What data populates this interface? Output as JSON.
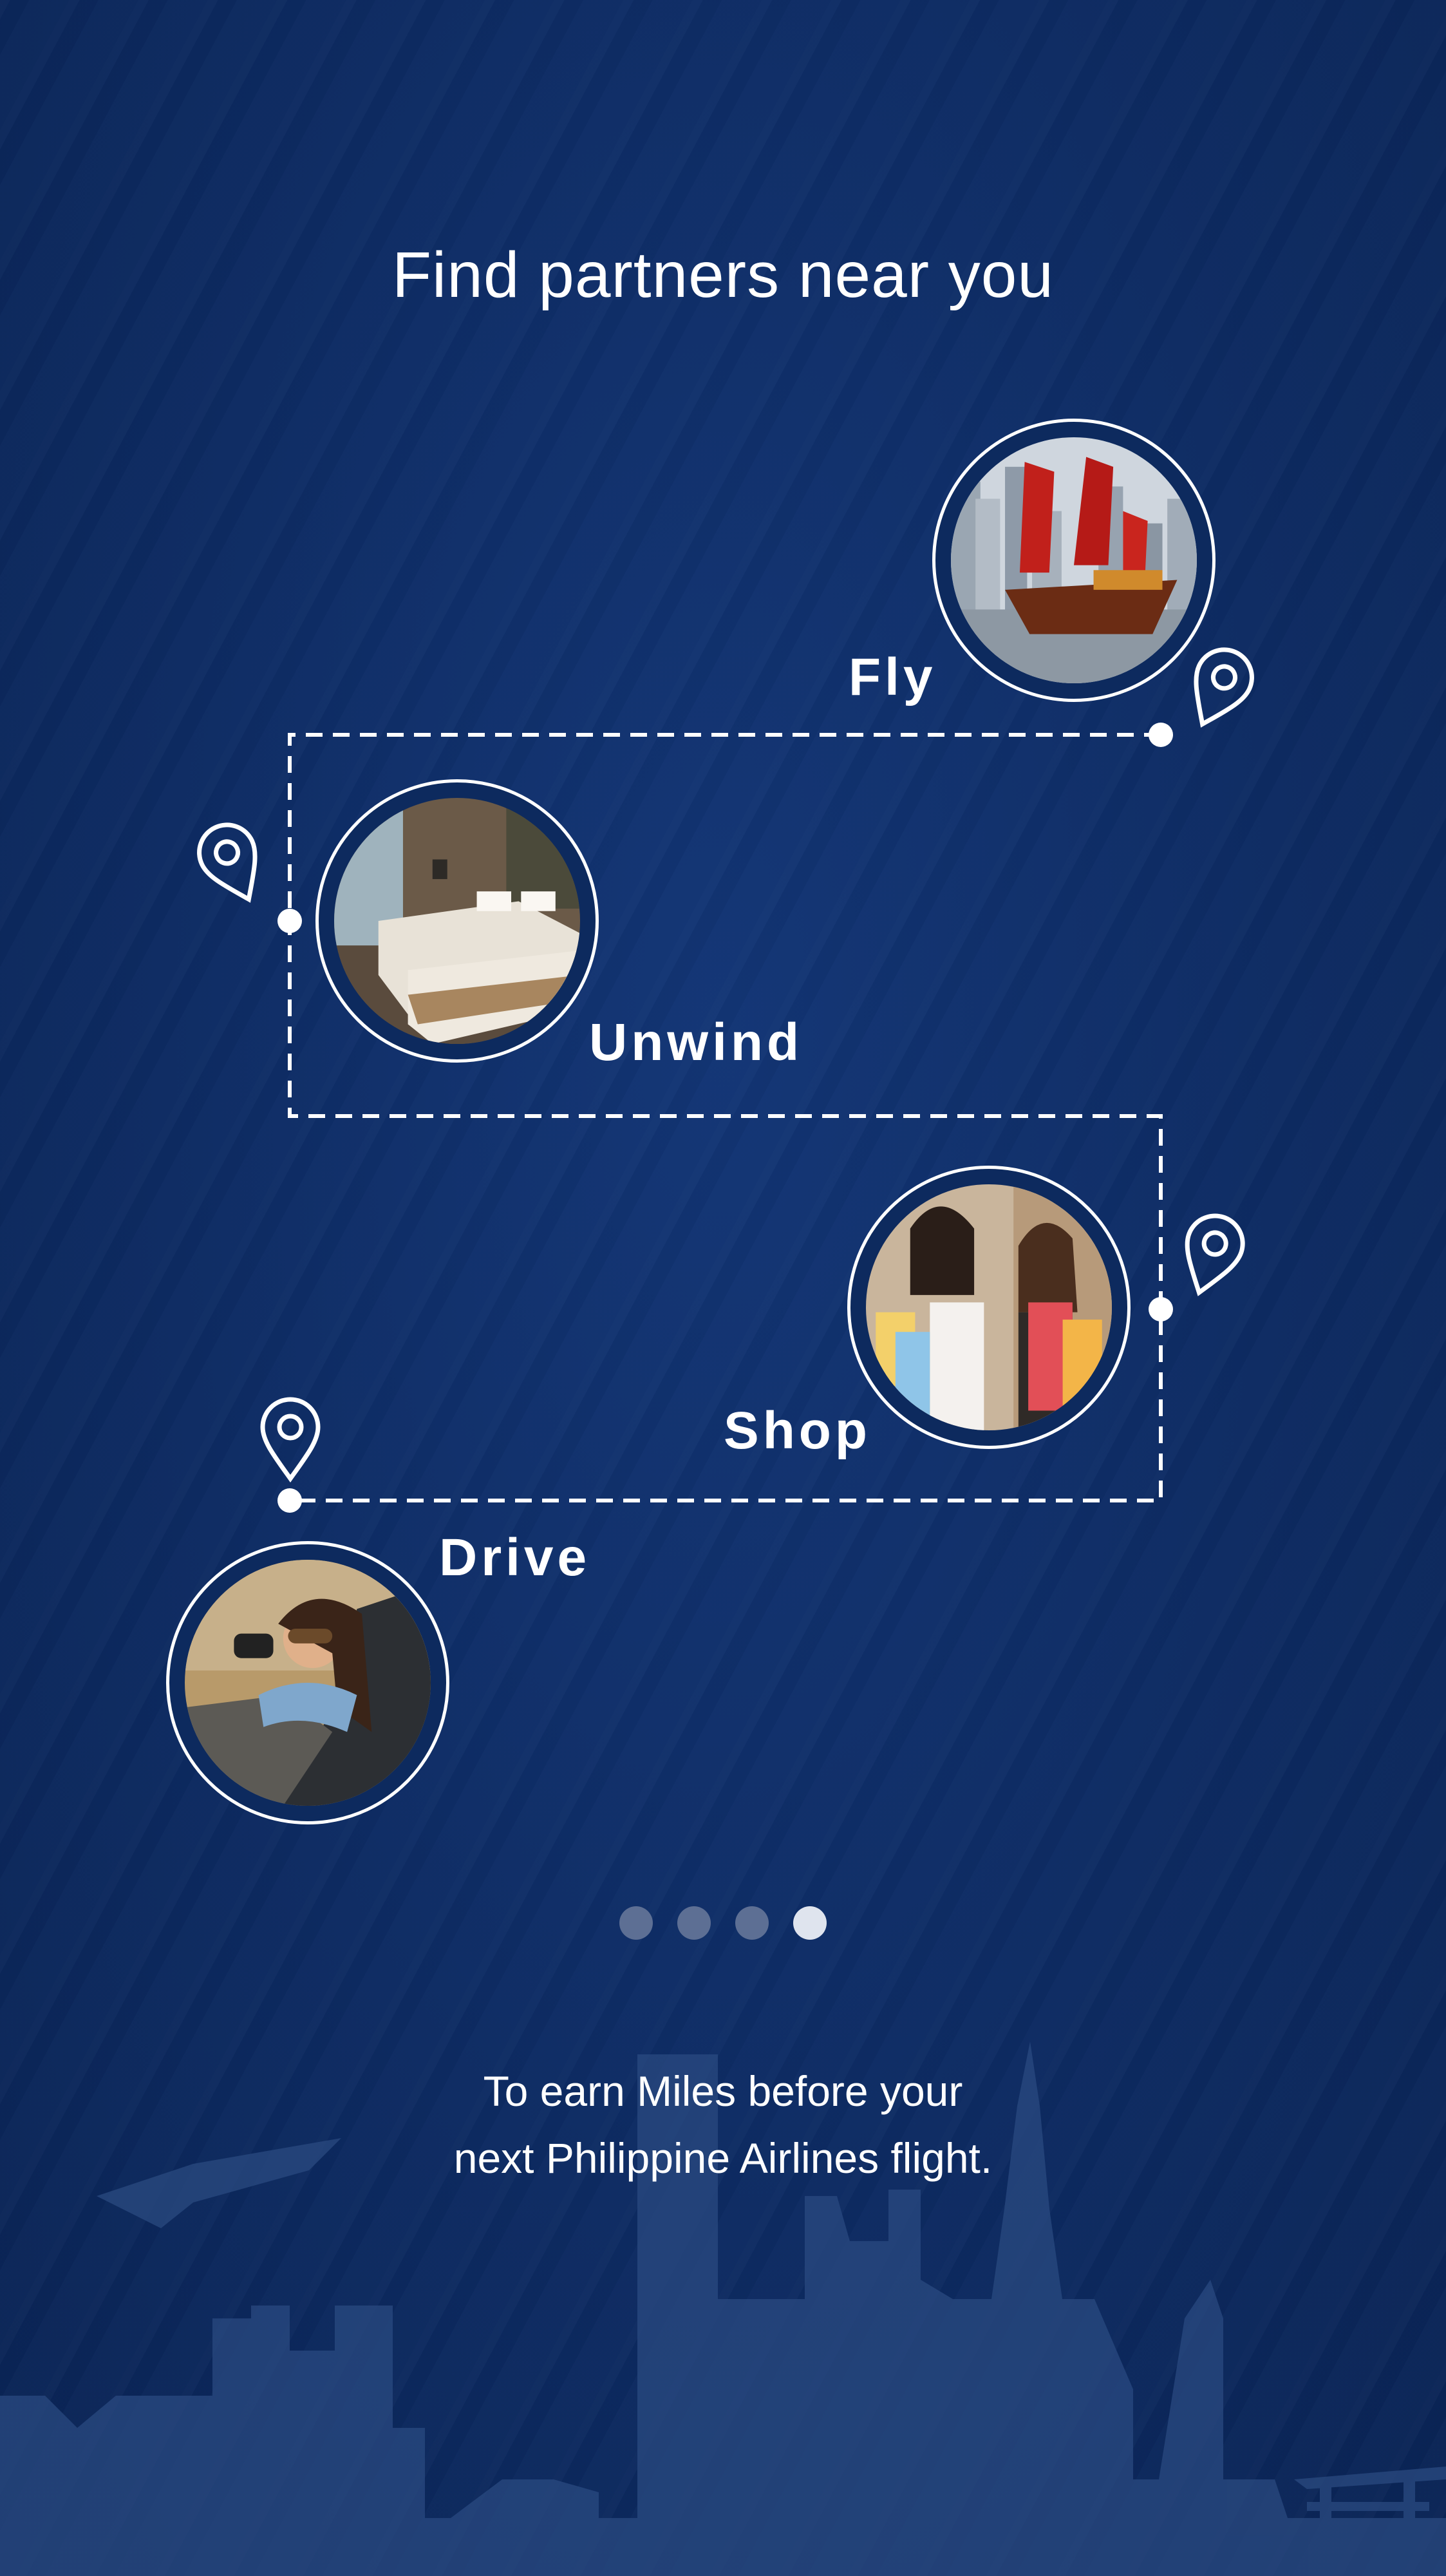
{
  "title": "Find partners near you",
  "partners": [
    {
      "label": "Fly",
      "icon": "junk-boat-harbor-photo"
    },
    {
      "label": "Unwind",
      "icon": "hotel-room-photo"
    },
    {
      "label": "Shop",
      "icon": "shopping-friends-photo"
    },
    {
      "label": "Drive",
      "icon": "woman-in-car-photo"
    }
  ],
  "pagination": {
    "total": 4,
    "current": 4
  },
  "caption": {
    "line1": "To earn Miles before your",
    "line2": "next Philippine Airlines flight."
  },
  "colors": {
    "background": "#0d2a5e",
    "accent": "#ffffff",
    "dot_inactive": "#5d6f94",
    "dot_active": "#dfe4ee"
  }
}
